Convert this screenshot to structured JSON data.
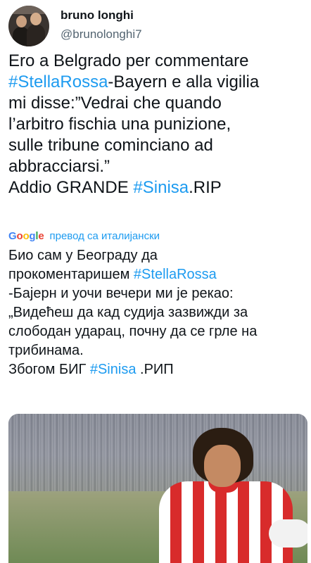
{
  "author": {
    "display_name": "bruno longhi",
    "handle": "@brunolonghi7"
  },
  "tweet": {
    "line1": "Ero a Belgrado per commentare",
    "line2_hashtag": "#StellaRossa",
    "line2_rest": "-Bayern e alla vigilia",
    "line3": "mi disse:”Vedrai che quando",
    "line4": "l’arbitro fischia una punizione,",
    "line5": "sulle tribune cominciano ad",
    "line6": "abbracciarsi.”",
    "line7_pre": "Addio GRANDE ",
    "line7_hashtag": "#Sinisa",
    "line7_post": ".RIP"
  },
  "translation": {
    "logo": [
      "G",
      "o",
      "o",
      "g",
      "l",
      "e"
    ],
    "link_label": "превод са италијански",
    "line1": "Био сам у Београду да",
    "line2_pre": "прокоментаришем ",
    "line2_hashtag": "#StellaRossa",
    "line3": "-Бајерн и уочи вечери ми је рекао:",
    "line4": "„Видећеш да кад судија зазвижди за",
    "line5": "слободан ударац, почну да се грле на",
    "line6": "трибинама.",
    "line7_pre": "Збогом БИГ ",
    "line7_hashtag": "#Sinisa",
    "line7_post": " .РИП"
  },
  "colors": {
    "link": "#1d9bf0",
    "text": "#0f1419",
    "secondary": "#536471"
  }
}
